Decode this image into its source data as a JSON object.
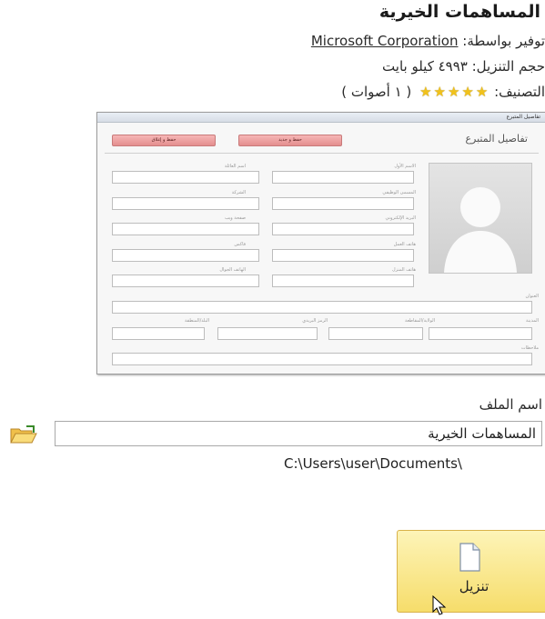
{
  "app": {
    "title": "المساهمات الخيرية",
    "provided_by_label": "توفير بواسطة:",
    "provider": "Microsoft Corporation",
    "size_text": "حجم التنزيل: ٤٩٩٣ كيلو بايت",
    "rating_label": "التصنيف:",
    "rating_stars": 5,
    "votes_text": "( ١ أصوات )"
  },
  "preview": {
    "window_title": "تفاصيل المتبرع",
    "heading": "تفاصيل المتبرع",
    "buttons": [
      "حفظ و جديد",
      "حفظ و إغلاق"
    ],
    "labels": [
      "الاسم الأول",
      "اسم العائلة",
      "المسمى الوظيفي",
      "الشركة",
      "البريد الإلكتروني",
      "صفحة ويب",
      "هاتف العمل",
      "فاكس",
      "هاتف المنزل",
      "الهاتف الجوال",
      "العنوان",
      "المدينة",
      "الولاية/المقاطعة",
      "الرمز البريدي",
      "البلد/المنطقة",
      "ملاحظات"
    ]
  },
  "file": {
    "name_label": "اسم الملف",
    "name_value": "المساهمات الخيرية",
    "path": "C:\\Users\\user\\Documents\\"
  },
  "download": {
    "label": "تنزيل"
  },
  "colors": {
    "star": "#f1c21b",
    "download_bg": "#f6dd6b",
    "preview_button": "#e48e8e"
  }
}
